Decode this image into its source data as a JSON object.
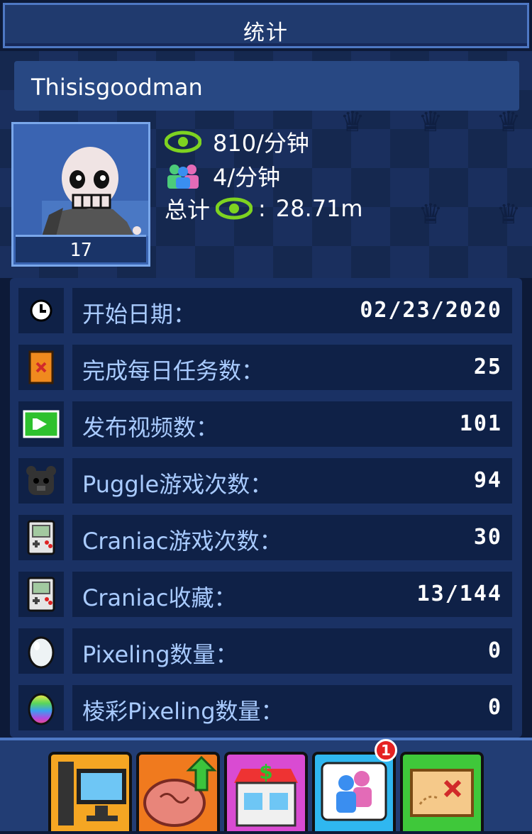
{
  "header": {
    "title": "统计"
  },
  "profile": {
    "username": "Thisisgoodman",
    "level": "17",
    "views_rate": "810/分钟",
    "subs_rate": "4/分钟",
    "total_label": "总计",
    "total_sep": ":",
    "total_value": "28.71m"
  },
  "stats": [
    {
      "icon": "clock-icon",
      "label": "开始日期：",
      "value": "02/23/2020"
    },
    {
      "icon": "quest-scroll-icon",
      "label": "完成每日任务数：",
      "value": "25"
    },
    {
      "icon": "video-icon",
      "label": "发布视频数：",
      "value": "101"
    },
    {
      "icon": "puggle-icon",
      "label": "Puggle游戏次数：",
      "value": "94"
    },
    {
      "icon": "handheld-console-icon",
      "label": "Craniac游戏次数：",
      "value": "30"
    },
    {
      "icon": "handheld-console-icon",
      "label": "Craniac收藏：",
      "value": "13/144"
    },
    {
      "icon": "egg-icon",
      "label": "Pixeling数量：",
      "value": "0"
    },
    {
      "icon": "rainbow-egg-icon",
      "label": "棱彩Pixeling数量：",
      "value": "0"
    }
  ],
  "nav": {
    "buttons": [
      {
        "icon": "computer-icon",
        "color": "#f5a623"
      },
      {
        "icon": "brain-upgrade-icon",
        "color": "#f07a1e"
      },
      {
        "icon": "shop-icon",
        "color": "#d94bd2"
      },
      {
        "icon": "social-icon",
        "color": "#2fb7f0"
      },
      {
        "icon": "map-icon",
        "color": "#3fc83a"
      }
    ],
    "badge_count": "1"
  },
  "colors": {
    "eye": "#7ed321",
    "label": "#a9cbff",
    "row_bg": "#0f2147",
    "panel_bg": "#1a3164"
  }
}
